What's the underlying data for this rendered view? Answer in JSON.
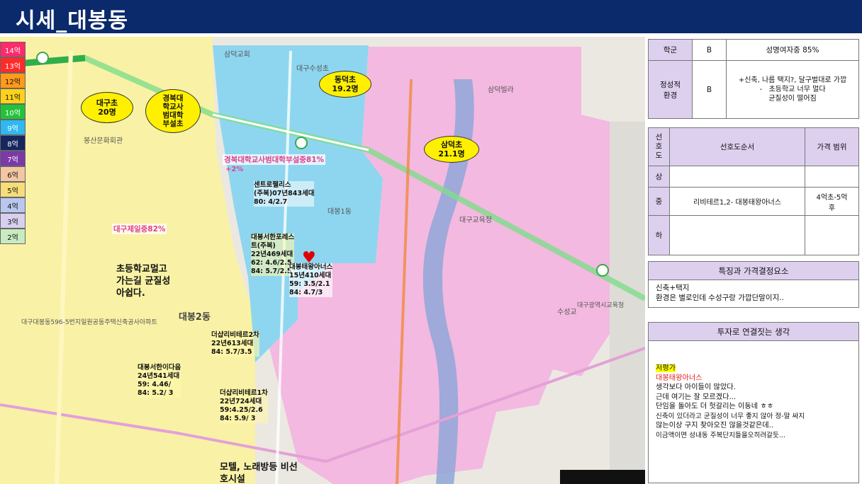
{
  "header": {
    "title": "시세_대봉동"
  },
  "legend": [
    {
      "label": "14억",
      "color": "#ff2a6a"
    },
    {
      "label": "13억",
      "color": "#ff2a2a"
    },
    {
      "label": "12억",
      "color": "#ff9a1a"
    },
    {
      "label": "11억",
      "color": "#ffd21a"
    },
    {
      "label": "10억",
      "color": "#24c23a"
    },
    {
      "label": "9억",
      "color": "#30b8f0"
    },
    {
      "label": "8억",
      "color": "#16265e"
    },
    {
      "label": "7억",
      "color": "#7a3aa8"
    },
    {
      "label": "6억",
      "color": "#f3c7a3"
    },
    {
      "label": "5억",
      "color": "#f7dd7a"
    },
    {
      "label": "4억",
      "color": "#b9c7ef"
    },
    {
      "label": "3억",
      "color": "#d8d0f0"
    },
    {
      "label": "2억",
      "color": "#c8ecc0"
    }
  ],
  "map": {
    "schools": [
      {
        "l1": "대구초",
        "l2": "20명"
      },
      {
        "l1": "경북대학교사범대학부설초",
        "lines": [
          "경북대",
          "학교사",
          "범대학",
          "부설초"
        ]
      },
      {
        "l1": "동덕초",
        "l2": "19.2명"
      },
      {
        "l1": "삼덕초",
        "l2": "21.1명"
      }
    ],
    "middle_schools": [
      {
        "label": "경북대학교사범대학부설중81%",
        "delta": "+2%"
      },
      {
        "label": "대구제일중82%"
      }
    ],
    "complexes": [
      {
        "text": "센트로팰리스\n(주복)07년843세대\n80: 4/2.7"
      },
      {
        "text": "대봉서한포레스\n트(주복)\n22년469세대\n62: 4.6/2.5\n84: 5.7/2.5"
      },
      {
        "text": "대봉태왕아너스\n15년410세대\n59: 3.5/2.1\n84: 4.7/3"
      },
      {
        "text": "더샵리비테르2차\n22년613세대\n84: 5.7/3.5"
      },
      {
        "text": "대봉서한이다음\n24년541세대\n59: 4.46/\n84: 5.2/ 3"
      },
      {
        "text": "더샵리비테르1차\n22년724세대\n59:4.25/2.6\n84: 5.9/ 3"
      }
    ],
    "notes": [
      "초등학교멀고\n가는길 균질성\n아쉽다.",
      "모텔, 노래방등 비선\n호시설"
    ],
    "place_labels": [
      "삼덕교회",
      "대구수성초",
      "대봉1동",
      "대봉2동",
      "봉산문화회관",
      "대구교육청",
      "삼덕빌라",
      "수성교",
      "대구광역시교육청",
      "대구대봉동596-5번지일원공동주택신축공사아파트"
    ]
  },
  "school_table": {
    "rows": [
      {
        "label": "학군",
        "grade": "B",
        "desc": "성명여자중 85%"
      },
      {
        "label": "정성적\n환경",
        "grade": "B",
        "desc": "+신축, 나름 택지?, 달구벌대로 가깝\n-   초등학교 너무 멀다\n균질성이 떨어짐"
      }
    ]
  },
  "pref_table": {
    "side_label": "선\n호\n도",
    "col_order": "선호도순서",
    "col_price": "가격 범위",
    "rows": [
      {
        "level": "상",
        "order": "",
        "price": ""
      },
      {
        "level": "중",
        "order": "리비테르1,2- 대봉태왕아너스",
        "price": "4억초-5억\n후"
      },
      {
        "level": "하",
        "order": "",
        "price": ""
      }
    ]
  },
  "features": {
    "title": "특징과  가격결정요소",
    "line1": "신축+택지",
    "line2": "환경은 별로인데 수성구랑 가깝단말이지.."
  },
  "thoughts": {
    "title": "투자로 연결짓는 생각",
    "cheap": "저평가",
    "name": "대봉태왕아너스",
    "lines": [
      "생각보다 아이들이 많았다.",
      "근데 여기는 잘 모르겠다...",
      "단임을 돌아도 더 헛갈리는 이동네 ㅎㅎ",
      "신축이 있더라고 균질성이 너무 좋지 않아 정-말 싸지",
      "않는이상 구지 찾아오진 않을것같은데..",
      "이금액이면 성내동 주복단지들을오히려갈듯..."
    ]
  }
}
